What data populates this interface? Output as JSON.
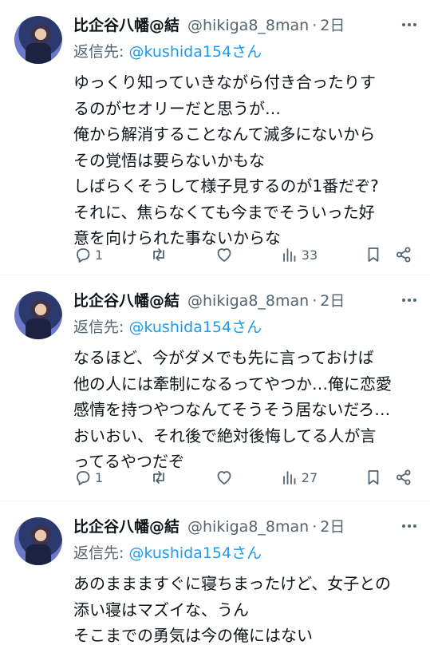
{
  "tweets": [
    {
      "name": "比企谷八幡@結",
      "handle": "@hikiga8_8man",
      "time": "2日",
      "reply_prefix": "返信先: ",
      "reply_user": "@kushida154さん",
      "lines": [
        "ゆっくり知っていきながら付き合ったりす",
        "るのがセオリーだと思うが…",
        "俺から解消することなんて滅多にないから",
        "その覚悟は要らないかもな",
        "しばらくそうして様子見するのが1番だぞ?",
        "それに、焦らなくても今までそういった好",
        "意を向けられた事ないからな"
      ],
      "reply_count": "1",
      "views": "33"
    },
    {
      "name": "比企谷八幡@結",
      "handle": "@hikiga8_8man",
      "time": "2日",
      "reply_prefix": "返信先: ",
      "reply_user": "@kushida154さん",
      "lines": [
        "なるほど、今がダメでも先に言っておけば",
        "他の人には牽制になるってやつか…俺に恋愛",
        "感情を持つやつなんてそうそう居ないだろ…",
        "おいおい、それ後で絶対後悔してる人が言",
        "ってるやつだぞ"
      ],
      "reply_count": "1",
      "views": "27"
    },
    {
      "name": "比企谷八幡@結",
      "handle": "@hikiga8_8man",
      "time": "2日",
      "reply_prefix": "返信先: ",
      "reply_user": "@kushida154さん",
      "lines": [
        "あのままますぐに寝ちまったけど、女子との",
        "添い寝はマズイな、うん",
        "そこまでの勇気は今の俺にはない"
      ]
    }
  ],
  "icons": {
    "more": "more-icon",
    "reply": "reply-icon",
    "retweet": "retweet-icon",
    "like": "heart-icon",
    "views": "views-icon",
    "bookmark": "bookmark-icon",
    "share": "share-icon"
  },
  "colors": {
    "link": "#1d9bf0",
    "muted": "#536471",
    "text": "#0f1419"
  }
}
